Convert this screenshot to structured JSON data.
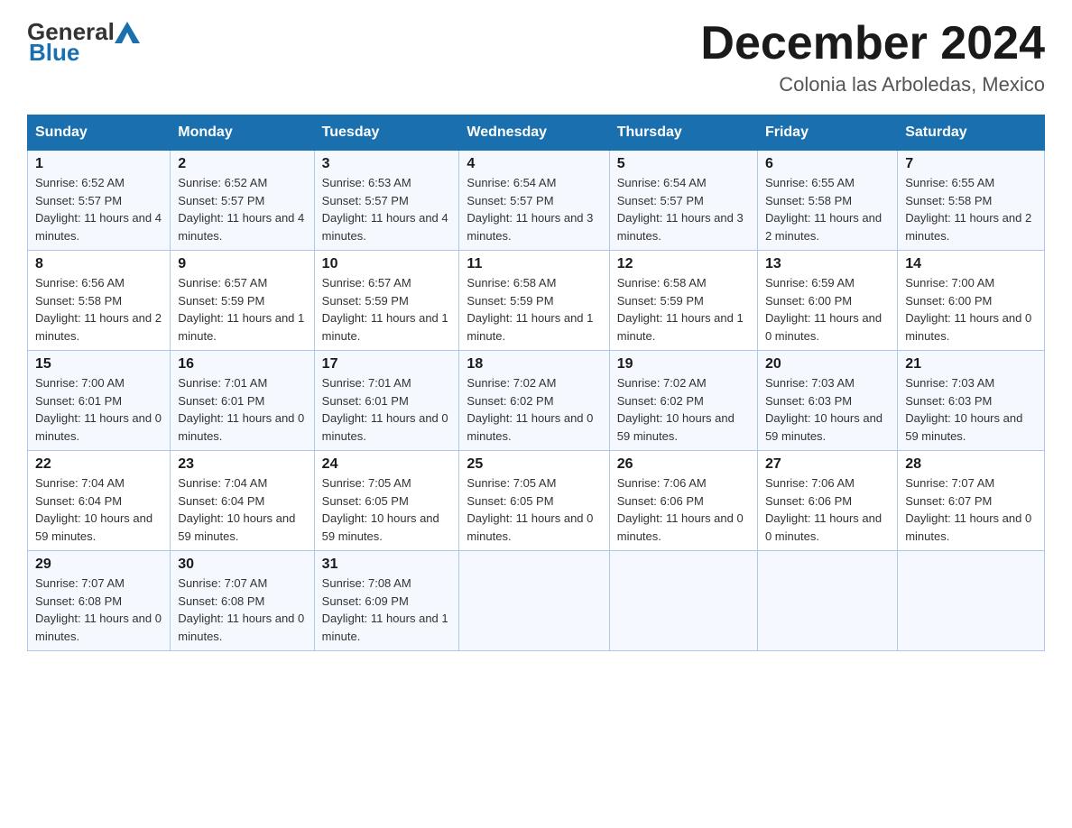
{
  "logo": {
    "text_general": "General",
    "text_blue": "Blue"
  },
  "title": "December 2024",
  "location": "Colonia las Arboledas, Mexico",
  "days_of_week": [
    "Sunday",
    "Monday",
    "Tuesday",
    "Wednesday",
    "Thursday",
    "Friday",
    "Saturday"
  ],
  "weeks": [
    [
      {
        "day": "1",
        "sunrise": "6:52 AM",
        "sunset": "5:57 PM",
        "daylight": "11 hours and 4 minutes."
      },
      {
        "day": "2",
        "sunrise": "6:52 AM",
        "sunset": "5:57 PM",
        "daylight": "11 hours and 4 minutes."
      },
      {
        "day": "3",
        "sunrise": "6:53 AM",
        "sunset": "5:57 PM",
        "daylight": "11 hours and 4 minutes."
      },
      {
        "day": "4",
        "sunrise": "6:54 AM",
        "sunset": "5:57 PM",
        "daylight": "11 hours and 3 minutes."
      },
      {
        "day": "5",
        "sunrise": "6:54 AM",
        "sunset": "5:57 PM",
        "daylight": "11 hours and 3 minutes."
      },
      {
        "day": "6",
        "sunrise": "6:55 AM",
        "sunset": "5:58 PM",
        "daylight": "11 hours and 2 minutes."
      },
      {
        "day": "7",
        "sunrise": "6:55 AM",
        "sunset": "5:58 PM",
        "daylight": "11 hours and 2 minutes."
      }
    ],
    [
      {
        "day": "8",
        "sunrise": "6:56 AM",
        "sunset": "5:58 PM",
        "daylight": "11 hours and 2 minutes."
      },
      {
        "day": "9",
        "sunrise": "6:57 AM",
        "sunset": "5:59 PM",
        "daylight": "11 hours and 1 minute."
      },
      {
        "day": "10",
        "sunrise": "6:57 AM",
        "sunset": "5:59 PM",
        "daylight": "11 hours and 1 minute."
      },
      {
        "day": "11",
        "sunrise": "6:58 AM",
        "sunset": "5:59 PM",
        "daylight": "11 hours and 1 minute."
      },
      {
        "day": "12",
        "sunrise": "6:58 AM",
        "sunset": "5:59 PM",
        "daylight": "11 hours and 1 minute."
      },
      {
        "day": "13",
        "sunrise": "6:59 AM",
        "sunset": "6:00 PM",
        "daylight": "11 hours and 0 minutes."
      },
      {
        "day": "14",
        "sunrise": "7:00 AM",
        "sunset": "6:00 PM",
        "daylight": "11 hours and 0 minutes."
      }
    ],
    [
      {
        "day": "15",
        "sunrise": "7:00 AM",
        "sunset": "6:01 PM",
        "daylight": "11 hours and 0 minutes."
      },
      {
        "day": "16",
        "sunrise": "7:01 AM",
        "sunset": "6:01 PM",
        "daylight": "11 hours and 0 minutes."
      },
      {
        "day": "17",
        "sunrise": "7:01 AM",
        "sunset": "6:01 PM",
        "daylight": "11 hours and 0 minutes."
      },
      {
        "day": "18",
        "sunrise": "7:02 AM",
        "sunset": "6:02 PM",
        "daylight": "11 hours and 0 minutes."
      },
      {
        "day": "19",
        "sunrise": "7:02 AM",
        "sunset": "6:02 PM",
        "daylight": "10 hours and 59 minutes."
      },
      {
        "day": "20",
        "sunrise": "7:03 AM",
        "sunset": "6:03 PM",
        "daylight": "10 hours and 59 minutes."
      },
      {
        "day": "21",
        "sunrise": "7:03 AM",
        "sunset": "6:03 PM",
        "daylight": "10 hours and 59 minutes."
      }
    ],
    [
      {
        "day": "22",
        "sunrise": "7:04 AM",
        "sunset": "6:04 PM",
        "daylight": "10 hours and 59 minutes."
      },
      {
        "day": "23",
        "sunrise": "7:04 AM",
        "sunset": "6:04 PM",
        "daylight": "10 hours and 59 minutes."
      },
      {
        "day": "24",
        "sunrise": "7:05 AM",
        "sunset": "6:05 PM",
        "daylight": "10 hours and 59 minutes."
      },
      {
        "day": "25",
        "sunrise": "7:05 AM",
        "sunset": "6:05 PM",
        "daylight": "11 hours and 0 minutes."
      },
      {
        "day": "26",
        "sunrise": "7:06 AM",
        "sunset": "6:06 PM",
        "daylight": "11 hours and 0 minutes."
      },
      {
        "day": "27",
        "sunrise": "7:06 AM",
        "sunset": "6:06 PM",
        "daylight": "11 hours and 0 minutes."
      },
      {
        "day": "28",
        "sunrise": "7:07 AM",
        "sunset": "6:07 PM",
        "daylight": "11 hours and 0 minutes."
      }
    ],
    [
      {
        "day": "29",
        "sunrise": "7:07 AM",
        "sunset": "6:08 PM",
        "daylight": "11 hours and 0 minutes."
      },
      {
        "day": "30",
        "sunrise": "7:07 AM",
        "sunset": "6:08 PM",
        "daylight": "11 hours and 0 minutes."
      },
      {
        "day": "31",
        "sunrise": "7:08 AM",
        "sunset": "6:09 PM",
        "daylight": "11 hours and 1 minute."
      },
      null,
      null,
      null,
      null
    ]
  ]
}
